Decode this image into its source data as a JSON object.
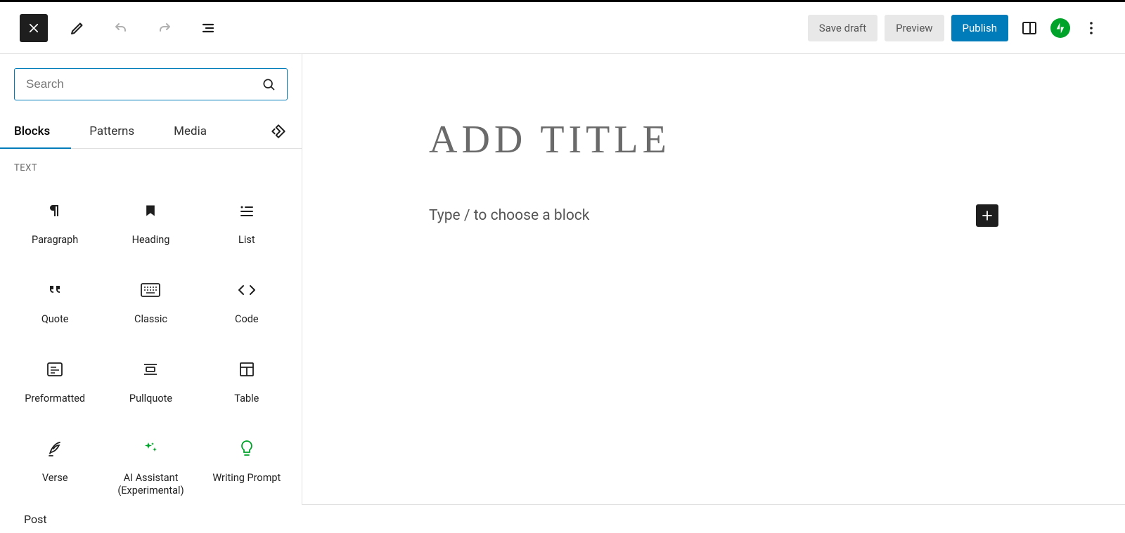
{
  "toolbar": {
    "save_draft": "Save draft",
    "preview": "Preview",
    "publish": "Publish"
  },
  "inserter": {
    "search_placeholder": "Search",
    "tabs": {
      "blocks": "Blocks",
      "patterns": "Patterns",
      "media": "Media"
    },
    "section_text": "TEXT",
    "blocks": [
      {
        "label": "Paragraph"
      },
      {
        "label": "Heading"
      },
      {
        "label": "List"
      },
      {
        "label": "Quote"
      },
      {
        "label": "Classic"
      },
      {
        "label": "Code"
      },
      {
        "label": "Preformatted"
      },
      {
        "label": "Pullquote"
      },
      {
        "label": "Table"
      },
      {
        "label": "Verse"
      },
      {
        "label": "AI Assistant (Experimental)"
      },
      {
        "label": "Writing Prompt"
      }
    ]
  },
  "editor": {
    "title_placeholder": "ADD TITLE",
    "body_placeholder": "Type / to choose a block"
  },
  "footer": {
    "breadcrumb": "Post"
  }
}
